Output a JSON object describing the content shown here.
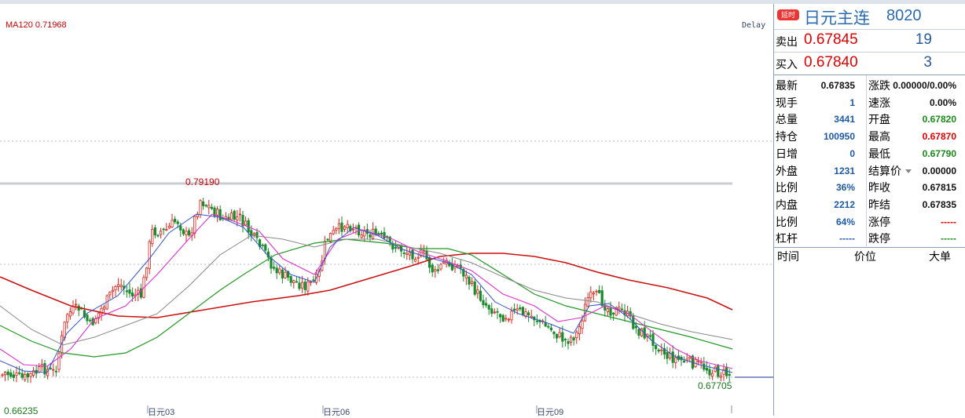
{
  "chart": {
    "ma_label": "MA120 0.71968",
    "delay_label": "Delay",
    "high_label": "0.79190",
    "last_low_label": "0.67705",
    "low_label": "0.66235",
    "x_labels": [
      "日元03",
      "日元06",
      "日元09"
    ],
    "colors": {
      "up": "#e0231c",
      "down": "#1a8a2a",
      "ma_red": "#cc1111",
      "ma_green": "#229922",
      "ma_magenta": "#dd33cc",
      "ma_blue": "#3355cc",
      "ma_gray": "#888888"
    }
  },
  "chart_data": {
    "type": "line",
    "title": "",
    "series": [
      {
        "name": "MA120",
        "last_value": 0.71968
      }
    ],
    "annotations": {
      "high": 0.7919,
      "low": 0.66235,
      "recent_low": 0.67705
    },
    "categories": [
      "日元03",
      "日元06",
      "日元09"
    ]
  },
  "panel": {
    "badge": "延时",
    "name": "日元主连",
    "code": "8020",
    "sell": {
      "label": "卖出",
      "price": "0.67845",
      "volume": "19"
    },
    "buy": {
      "label": "买入",
      "price": "0.67840",
      "volume": "3"
    },
    "left_stats": [
      {
        "label": "最新",
        "value": "0.67835",
        "color": "black"
      },
      {
        "label": "现手",
        "value": "1",
        "color": "blue"
      },
      {
        "label": "总量",
        "value": "3441",
        "color": "blue"
      },
      {
        "label": "持仓",
        "value": "100950",
        "color": "blue"
      },
      {
        "label": "日增",
        "value": "0",
        "color": "blue"
      },
      {
        "label": "外盘",
        "value": "1231",
        "color": "blue"
      },
      {
        "label": "比例",
        "value": "36%",
        "color": "blue"
      },
      {
        "label": "内盘",
        "value": "2212",
        "color": "blue"
      },
      {
        "label": "比例",
        "value": "64%",
        "color": "blue"
      },
      {
        "label": "杠杆",
        "value": "-----",
        "color": "blue"
      }
    ],
    "right_stats": [
      {
        "label": "涨跌",
        "value": "0.00000/0.00%",
        "color": "black"
      },
      {
        "label": "速涨",
        "value": "0.00%",
        "color": "black"
      },
      {
        "label": "开盘",
        "value": "0.67820",
        "color": "green"
      },
      {
        "label": "最高",
        "value": "0.67870",
        "color": "red"
      },
      {
        "label": "最低",
        "value": "0.67790",
        "color": "green"
      },
      {
        "label": "结算价",
        "value": "0.00000",
        "color": "black"
      },
      {
        "label": "昨收",
        "value": "0.67815",
        "color": "black"
      },
      {
        "label": "昨结",
        "value": "0.67835",
        "color": "black"
      },
      {
        "label": "涨停",
        "value": "-----",
        "color": "red"
      },
      {
        "label": "跌停",
        "value": "-----",
        "color": "green"
      }
    ],
    "tick_headers": [
      "时间",
      "价位",
      "大单"
    ]
  }
}
